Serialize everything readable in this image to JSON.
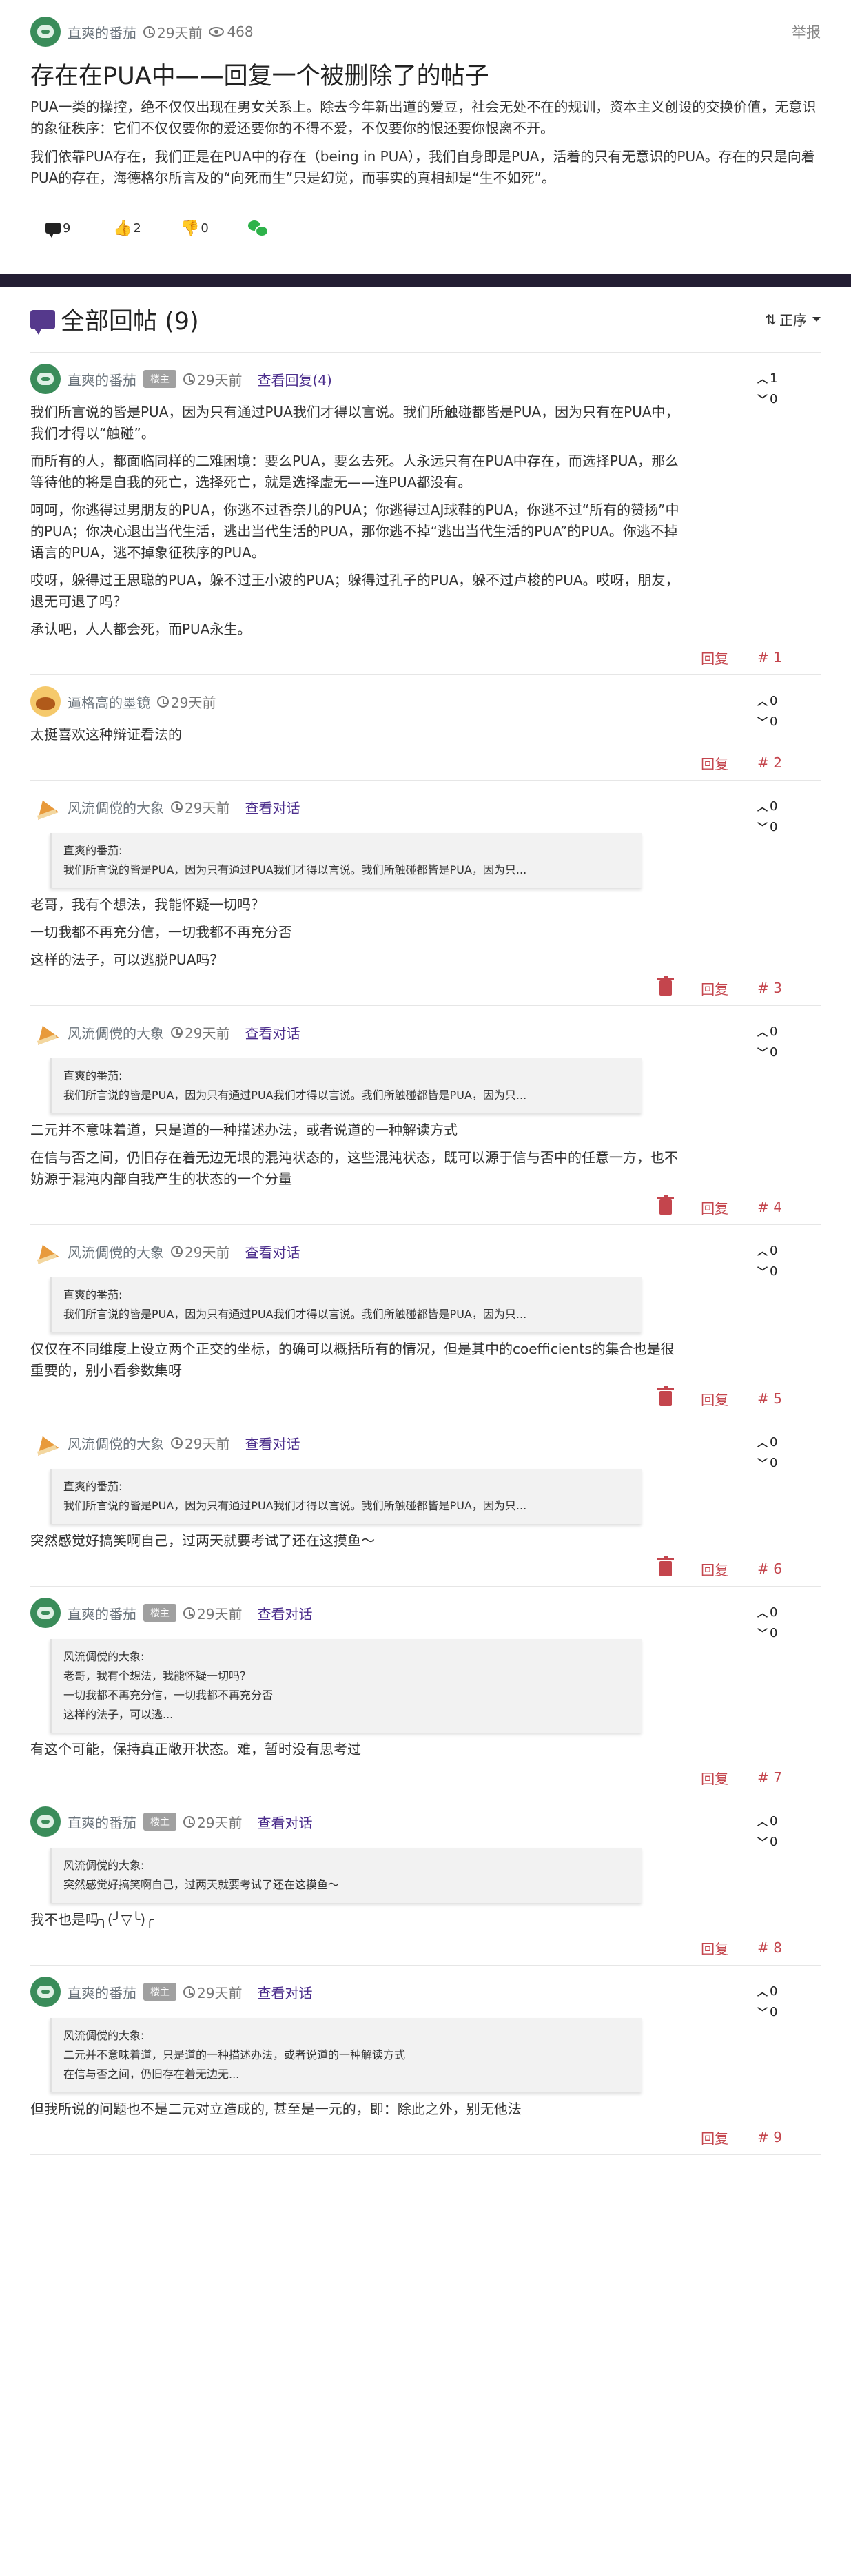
{
  "post": {
    "author": "直爽的番茄",
    "time": "29天前",
    "views": "468",
    "report_label": "举报",
    "title": "存在在PUA中——回复一个被删除了的帖子",
    "paragraphs": [
      "PUA一类的操控，绝不仅仅出现在男女关系上。除去今年新出道的爱豆，社会无处不在的规训，资本主义创设的交换价值，无意识的象征秩序：它们不仅仅要你的爱还要你的不得不爱，不仅要你的恨还要你恨离不开。",
      "我们依靠PUA存在，我们正是在PUA中的存在（being in PUA），我们自身即是PUA，活着的只有无意识的PUA。存在的只是向着PUA的存在，海德格尔所言及的“向死而生”只是幻觉，而事实的真相却是“生不如死”。"
    ],
    "actions": {
      "comments": "9",
      "likes": "2",
      "dislikes": "0"
    }
  },
  "replies_header": {
    "title": "全部回帖 (9)",
    "sort_label": "正序"
  },
  "replies": [
    {
      "author": "直爽的番茄",
      "avatar": "green",
      "op_badge": "楼主",
      "time": "29天前",
      "link": "查看回复(4)",
      "up": "1",
      "down": "0",
      "quote": null,
      "paragraphs": [
        "我们所言说的皆是PUA，因为只有通过PUA我们才得以言说。我们所触碰都皆是PUA，因为只有在PUA中，我们才得以“触碰”。",
        "而所有的人，都面临同样的二难困境：要么PUA，要么去死。人永远只有在PUA中存在，而选择PUA，那么等待他的将是自我的死亡，选择死亡，就是选择虚无——连PUA都没有。",
        "呵呵，你逃得过男朋友的PUA，你逃不过香奈儿的PUA；你逃得过AJ球鞋的PUA，你逃不过“所有的赞扬”中的PUA；你决心退出当代生活，逃出当代生活的PUA，那你逃不掉“逃出当代生活的PUA”的PUA。你逃不掉语言的PUA，逃不掉象征秩序的PUA。",
        "哎呀，躲得过王思聪的PUA，躲不过王小波的PUA；躲得过孔子的PUA，躲不过卢梭的PUA。哎呀，朋友，退无可退了吗？",
        "承认吧，人人都会死，而PUA永生。"
      ],
      "reply_label": "回复",
      "floor": "# 1",
      "trash": false
    },
    {
      "author": "逼格高的墨镜",
      "avatar": "yellow",
      "op_badge": null,
      "time": "29天前",
      "link": null,
      "up": "0",
      "down": "0",
      "quote": null,
      "paragraphs": [
        "太挺喜欢这种辩证看法的"
      ],
      "reply_label": "回复",
      "floor": "# 2",
      "trash": false
    },
    {
      "author": "风流倜傥的大象",
      "avatar": "cake",
      "op_badge": null,
      "time": "29天前",
      "link": "查看对话",
      "up": "0",
      "down": "0",
      "quote": [
        "直爽的番茄:",
        "我们所言说的皆是PUA，因为只有通过PUA我们才得以言说。我们所触碰都皆是PUA，因为只..."
      ],
      "paragraphs": [
        "老哥，我有个想法，我能怀疑一切吗？",
        "一切我都不再充分信，一切我都不再充分否",
        "这样的法子，可以逃脱PUA吗？"
      ],
      "reply_label": "回复",
      "floor": "# 3",
      "trash": true
    },
    {
      "author": "风流倜傥的大象",
      "avatar": "cake",
      "op_badge": null,
      "time": "29天前",
      "link": "查看对话",
      "up": "0",
      "down": "0",
      "quote": [
        "直爽的番茄:",
        "我们所言说的皆是PUA，因为只有通过PUA我们才得以言说。我们所触碰都皆是PUA，因为只..."
      ],
      "paragraphs": [
        "二元并不意味着道，只是道的一种描述办法，或者说道的一种解读方式",
        "在信与否之间，仍旧存在着无边无垠的混沌状态的，这些混沌状态，既可以源于信与否中的任意一方，也不妨源于混沌内部自我产生的状态的一个分量"
      ],
      "reply_label": "回复",
      "floor": "# 4",
      "trash": true
    },
    {
      "author": "风流倜傥的大象",
      "avatar": "cake",
      "op_badge": null,
      "time": "29天前",
      "link": "查看对话",
      "up": "0",
      "down": "0",
      "quote": [
        "直爽的番茄:",
        "我们所言说的皆是PUA，因为只有通过PUA我们才得以言说。我们所触碰都皆是PUA，因为只..."
      ],
      "paragraphs": [
        "仅仅在不同维度上设立两个正交的坐标，的确可以概括所有的情况，但是其中的coefficients的集合也是很重要的，别小看参数集呀"
      ],
      "reply_label": "回复",
      "floor": "# 5",
      "trash": true
    },
    {
      "author": "风流倜傥的大象",
      "avatar": "cake",
      "op_badge": null,
      "time": "29天前",
      "link": "查看对话",
      "up": "0",
      "down": "0",
      "quote": [
        "直爽的番茄:",
        "我们所言说的皆是PUA，因为只有通过PUA我们才得以言说。我们所触碰都皆是PUA，因为只..."
      ],
      "paragraphs": [
        "突然感觉好搞笑啊自己，过两天就要考试了还在这摸鱼～"
      ],
      "reply_label": "回复",
      "floor": "# 6",
      "trash": true
    },
    {
      "author": "直爽的番茄",
      "avatar": "green",
      "op_badge": "楼主",
      "time": "29天前",
      "link": "查看对话",
      "up": "0",
      "down": "0",
      "quote": [
        "风流倜傥的大象:",
        "老哥，我有个想法，我能怀疑一切吗？",
        "一切我都不再充分信，一切我都不再充分否",
        "这样的法子，可以逃..."
      ],
      "paragraphs": [
        "有这个可能，保持真正敞开状态。难，暂时没有思考过"
      ],
      "reply_label": "回复",
      "floor": "# 7",
      "trash": false
    },
    {
      "author": "直爽的番茄",
      "avatar": "green",
      "op_badge": "楼主",
      "time": "29天前",
      "link": "查看对话",
      "up": "0",
      "down": "0",
      "quote": [
        "风流倜傥的大象:",
        "突然感觉好搞笑啊自己，过两天就要考试了还在这摸鱼～"
      ],
      "paragraphs": [
        "我不也是吗╮(╯▽╰)╭"
      ],
      "reply_label": "回复",
      "floor": "# 8",
      "trash": false
    },
    {
      "author": "直爽的番茄",
      "avatar": "green",
      "op_badge": "楼主",
      "time": "29天前",
      "link": "查看对话",
      "up": "0",
      "down": "0",
      "quote": [
        "风流倜傥的大象:",
        "二元并不意味着道，只是道的一种描述办法，或者说道的一种解读方式",
        "在信与否之间，仍旧存在着无边无..."
      ],
      "paragraphs": [
        "但我所说的问题也不是二元对立造成的, 甚至是一元的，即：除此之外，别无他法"
      ],
      "reply_label": "回复",
      "floor": "# 9",
      "trash": false
    }
  ]
}
